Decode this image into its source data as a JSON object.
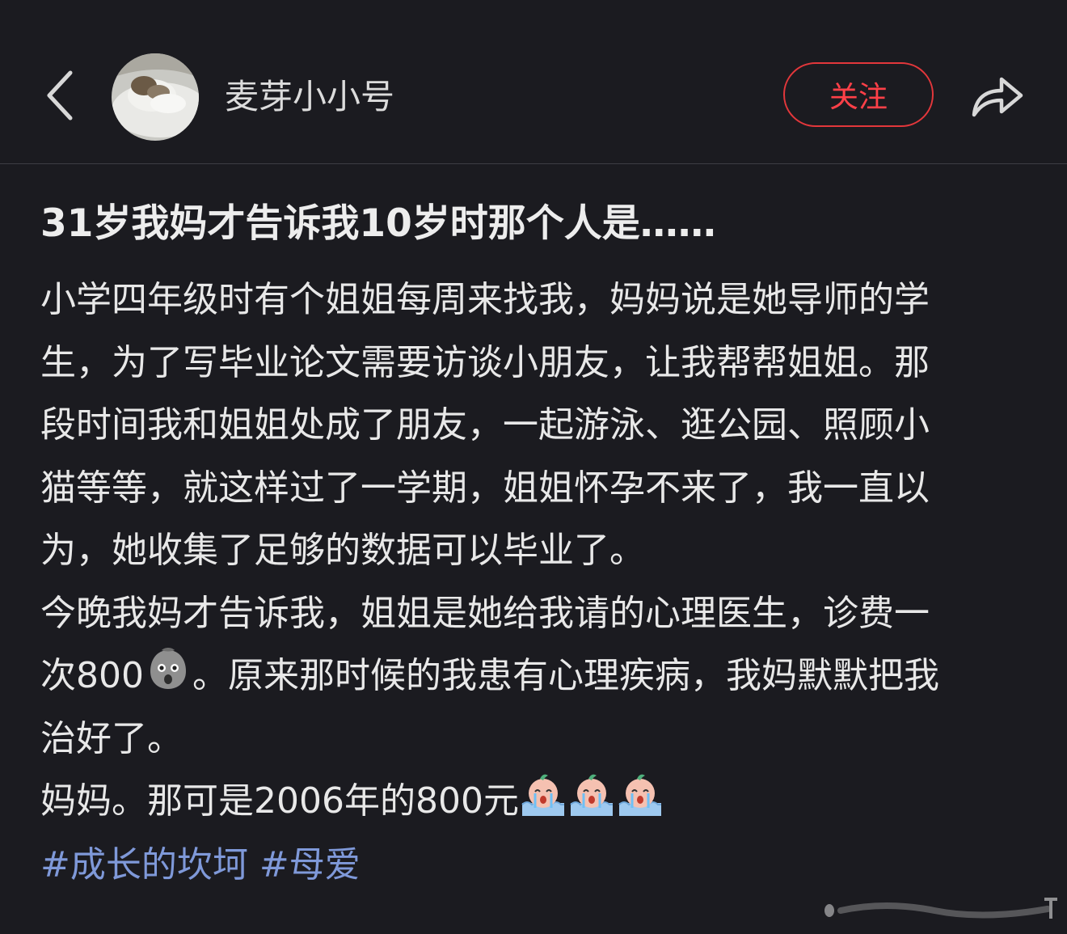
{
  "header": {
    "back_icon": "chevron-left-icon",
    "author_name": "麦芽小小号",
    "follow_label": "关注",
    "share_icon": "share-arrow-icon",
    "accent_color": "#e3373b"
  },
  "post": {
    "title": "31岁我妈才告诉我10岁时那个人是……",
    "lines": [
      "小学四年级时有个姐姐每周来找我，妈妈说是她导师的学",
      "生，为了写毕业论文需要访谈小朋友，让我帮帮姐姐。那",
      "段时间我和姐姐处成了朋友，一起游泳、逛公园、照顾小",
      "猫等等，就这样过了一学期，姐姐怀孕不来了，我一直以",
      "为，她收集了足够的数据可以毕业了。",
      "今晚我妈才告诉我，姐姐是她给我请的心理医生，诊费一"
    ],
    "line7_before": "次800",
    "line7_after": "。原来那时候的我患有心理疾病，我妈默默把我",
    "line8": "治好了。",
    "line9": "妈妈。那可是2006年的800元",
    "emoji_shocked": "shocked-face-emoji",
    "emoji_crying": "crying-peach-emoji",
    "hashtags": [
      "#成长的坎坷",
      "#母爱"
    ],
    "hashtag_color": "#7f99d9"
  }
}
